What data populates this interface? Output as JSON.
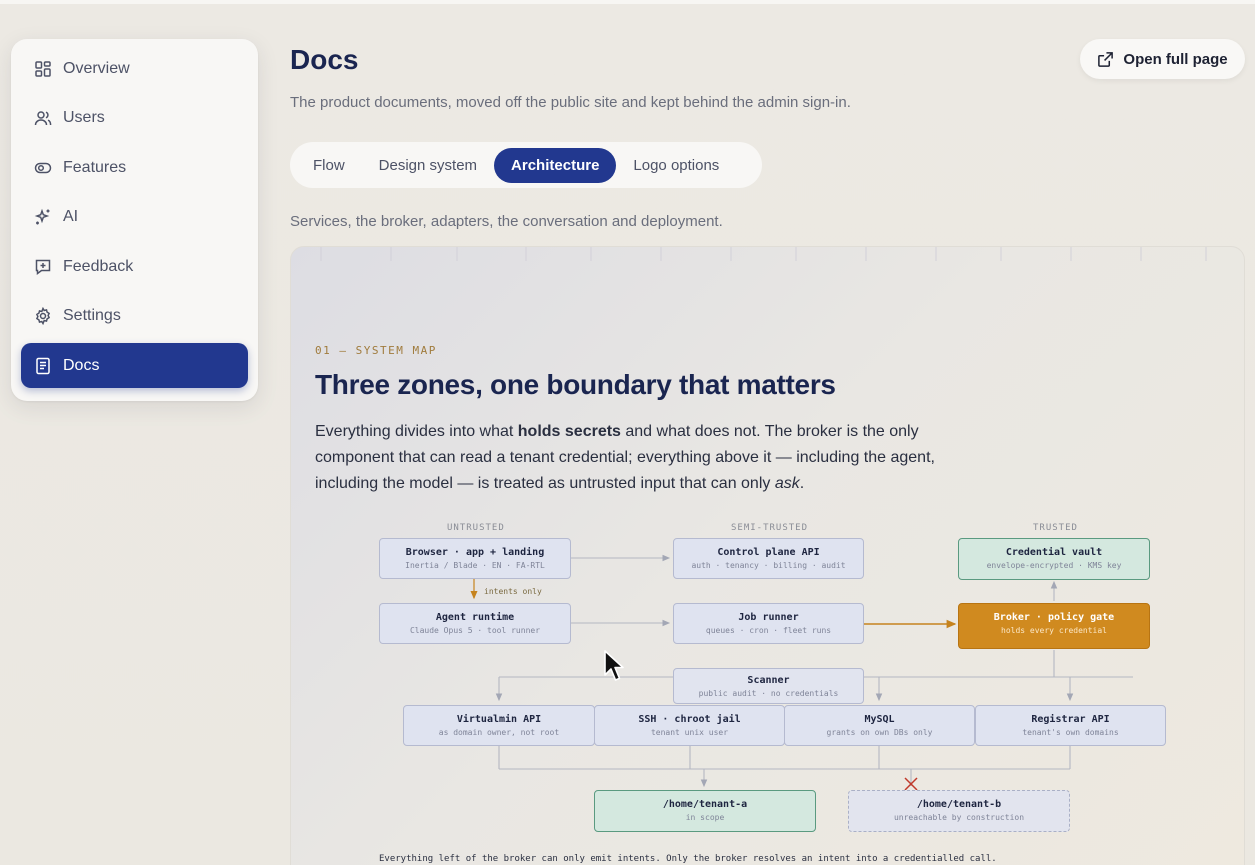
{
  "sidebar": {
    "items": [
      {
        "label": "Overview",
        "icon": "grid-icon"
      },
      {
        "label": "Users",
        "icon": "users-icon"
      },
      {
        "label": "Features",
        "icon": "toggle-icon"
      },
      {
        "label": "AI",
        "icon": "sparkle-icon"
      },
      {
        "label": "Feedback",
        "icon": "feedback-icon"
      },
      {
        "label": "Settings",
        "icon": "gear-icon"
      },
      {
        "label": "Docs",
        "icon": "document-icon"
      }
    ],
    "active": "Docs"
  },
  "header": {
    "title": "Docs",
    "subtitle": "The product documents, moved off the public site and kept behind the admin sign-in.",
    "open_full_page": "Open full page"
  },
  "tabs": [
    {
      "label": "Flow"
    },
    {
      "label": "Design system"
    },
    {
      "label": "Architecture"
    },
    {
      "label": "Logo options"
    }
  ],
  "active_tab": "Architecture",
  "section_subtitle": "Services, the broker, adapters, the conversation and deployment.",
  "doc": {
    "eyebrow": "01 — SYSTEM MAP",
    "headline": "Three zones, one boundary that matters",
    "para_pre": "Everything divides into what ",
    "para_bold": "holds secrets",
    "para_mid": " and what does not. The broker is the only component that can read a tenant credential; everything above it — including the agent, including the model — is treated as untrusted input that can only ",
    "para_em": "ask",
    "para_end": ".",
    "zones": {
      "untrusted": "UNTRUSTED",
      "semi": "SEMI-TRUSTED",
      "trusted": "TRUSTED"
    },
    "nodes": {
      "browser": {
        "title": "Browser · app + landing",
        "sub": "Inertia / Blade · EN · FA-RTL"
      },
      "control": {
        "title": "Control plane API",
        "sub": "auth · tenancy · billing · audit"
      },
      "vault": {
        "title": "Credential vault",
        "sub": "envelope-encrypted · KMS key"
      },
      "agent": {
        "title": "Agent runtime",
        "sub": "Claude Opus 5 · tool runner"
      },
      "job": {
        "title": "Job runner",
        "sub": "queues · cron · fleet runs"
      },
      "broker": {
        "title": "Broker · policy gate",
        "sub": "holds every credential"
      },
      "scanner": {
        "title": "Scanner",
        "sub": "public audit · no credentials"
      },
      "virtualmin": {
        "title": "Virtualmin API",
        "sub": "as domain owner, not root"
      },
      "ssh": {
        "title": "SSH · chroot jail",
        "sub": "tenant unix user"
      },
      "mysql": {
        "title": "MySQL",
        "sub": "grants on own DBs only"
      },
      "registrar": {
        "title": "Registrar API",
        "sub": "tenant's own domains"
      },
      "tenant_a": {
        "title": "/home/tenant-a",
        "sub": "in scope"
      },
      "tenant_b": {
        "title": "/home/tenant-b",
        "sub": "unreachable by construction"
      }
    },
    "intents_label": "intents only",
    "footnote": "Everything left of the broker can only emit intents. Only the broker resolves an intent into a credentialled call."
  },
  "colors": {
    "accent": "#22388f",
    "broker": "#d08a1f",
    "trusted": "#d4e8df",
    "deny": "#c0392b"
  }
}
